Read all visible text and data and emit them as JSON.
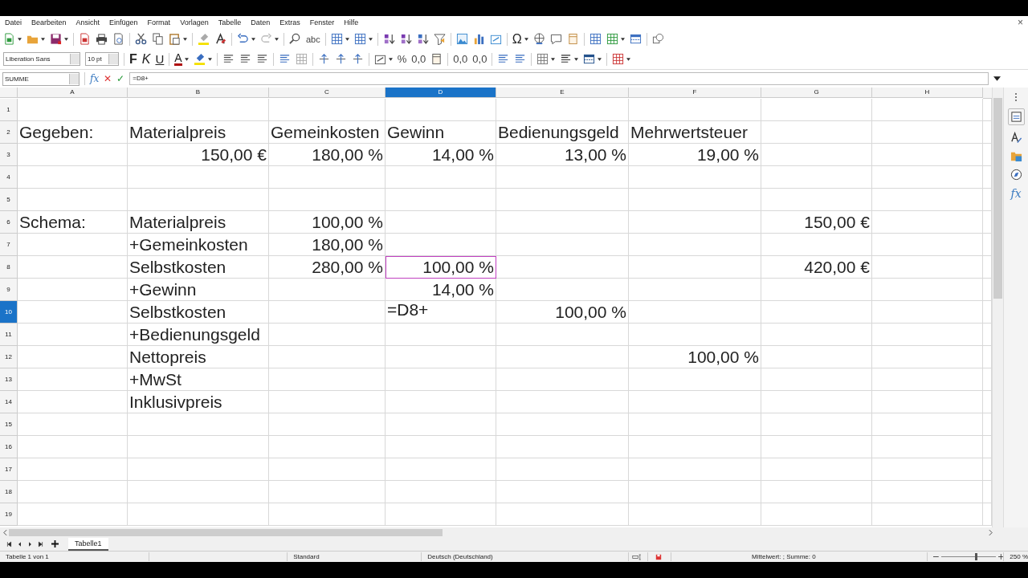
{
  "menu": [
    "Datei",
    "Bearbeiten",
    "Ansicht",
    "Einfügen",
    "Format",
    "Vorlagen",
    "Tabelle",
    "Daten",
    "Extras",
    "Fenster",
    "Hilfe"
  ],
  "close_glyph": "×",
  "toolbar": {
    "spelling": "abc",
    "special_char": "Ω",
    "bold": "F",
    "italic": "K",
    "underline": "U",
    "font_color": "A",
    "percent": "%",
    "number_format": "0,0",
    "add_decimal": "0,0",
    "delete_decimal": "0,0",
    "font_name": "Liberation Sans",
    "font_size": "10 pt"
  },
  "formula_bar": {
    "name_box": "SUMME",
    "function_wizard": "fx",
    "cancel": "✕",
    "accept": "✓",
    "formula": "=D8+"
  },
  "columns": [
    {
      "label": "A",
      "selected": false
    },
    {
      "label": "B",
      "selected": false
    },
    {
      "label": "C",
      "selected": false
    },
    {
      "label": "D",
      "selected": true
    },
    {
      "label": "E",
      "selected": false
    },
    {
      "label": "F",
      "selected": false
    },
    {
      "label": "G",
      "selected": false
    },
    {
      "label": "H",
      "selected": false
    }
  ],
  "rows": [
    {
      "label": "1",
      "selected": false
    },
    {
      "label": "2",
      "selected": false,
      "cells": [
        {
          "text": "Gegeben:",
          "kind": "label"
        },
        {
          "text": "Materialpreis",
          "kind": "label"
        },
        {
          "text": "Gemeinkosten",
          "kind": "label"
        },
        {
          "text": "Gewinn",
          "kind": "label"
        },
        {
          "text": "Bedienungsgeld",
          "kind": "label"
        },
        {
          "text": "Mehrwertsteuer",
          "kind": "label"
        },
        null,
        null
      ]
    },
    {
      "label": "3",
      "selected": false,
      "cells": [
        null,
        {
          "text": "150,00 €",
          "kind": "number"
        },
        {
          "text": "180,00 %",
          "kind": "number"
        },
        {
          "text": "14,00 %",
          "kind": "number"
        },
        {
          "text": "13,00 %",
          "kind": "number"
        },
        {
          "text": "19,00 %",
          "kind": "number"
        },
        null,
        null
      ]
    },
    {
      "label": "4",
      "selected": false
    },
    {
      "label": "5",
      "selected": false
    },
    {
      "label": "6",
      "selected": false,
      "cells": [
        {
          "text": "Schema:",
          "kind": "label"
        },
        {
          "text": "Materialpreis",
          "kind": "label"
        },
        {
          "text": "100,00 %",
          "kind": "number"
        },
        null,
        null,
        null,
        {
          "text": "150,00 €",
          "kind": "number"
        },
        null
      ]
    },
    {
      "label": "7",
      "selected": false,
      "cells": [
        null,
        {
          "text": "+Gemeinkosten",
          "kind": "label"
        },
        {
          "text": "180,00 %",
          "kind": "number"
        },
        null,
        null,
        null,
        null,
        null
      ]
    },
    {
      "label": "8",
      "selected": false,
      "cells": [
        null,
        {
          "text": "Selbstkosten",
          "kind": "label"
        },
        {
          "text": "280,00 %",
          "kind": "number"
        },
        {
          "text": "100,00 %",
          "kind": "number",
          "referenced": true
        },
        null,
        null,
        {
          "text": "420,00 €",
          "kind": "number"
        },
        null
      ]
    },
    {
      "label": "9",
      "selected": false,
      "cells": [
        null,
        {
          "text": "+Gewinn",
          "kind": "label"
        },
        null,
        {
          "text": "14,00 %",
          "kind": "number"
        },
        null,
        null,
        null,
        null
      ]
    },
    {
      "label": "10",
      "selected": true,
      "cells": [
        null,
        {
          "text": "Selbstkosten",
          "kind": "label"
        },
        null,
        {
          "text": "=D8+",
          "kind": "formula",
          "editing": true
        },
        {
          "text": "100,00 %",
          "kind": "number"
        },
        null,
        null,
        null
      ]
    },
    {
      "label": "11",
      "selected": false,
      "cells": [
        null,
        {
          "text": "+Bedienungsgeld",
          "kind": "label"
        },
        null,
        null,
        null,
        null,
        null,
        null
      ]
    },
    {
      "label": "12",
      "selected": false,
      "cells": [
        null,
        {
          "text": "Nettopreis",
          "kind": "label"
        },
        null,
        null,
        null,
        {
          "text": "100,00 %",
          "kind": "number"
        },
        null,
        null
      ]
    },
    {
      "label": "13",
      "selected": false,
      "cells": [
        null,
        {
          "text": "+MwSt",
          "kind": "label"
        },
        null,
        null,
        null,
        null,
        null,
        null
      ]
    },
    {
      "label": "14",
      "selected": false,
      "cells": [
        null,
        {
          "text": "Inklusivpreis",
          "kind": "label"
        },
        null,
        null,
        null,
        null,
        null,
        null
      ]
    },
    {
      "label": "15",
      "selected": false
    },
    {
      "label": "16",
      "selected": false
    },
    {
      "label": "17",
      "selected": false
    },
    {
      "label": "18",
      "selected": false
    },
    {
      "label": "19",
      "selected": false
    }
  ],
  "sheet_tabs": [
    {
      "label": "Tabelle1",
      "selected": true
    }
  ],
  "status_bar": {
    "sheet": "Tabelle 1 von 1",
    "style": "Standard",
    "language": "Deutsch (Deutschland)",
    "sum": "Mittelwert: ; Summe: 0",
    "zoom_slider": {
      "level": 0.62
    },
    "zoom": "250 %"
  },
  "sidebar": {
    "functions": "fx"
  }
}
